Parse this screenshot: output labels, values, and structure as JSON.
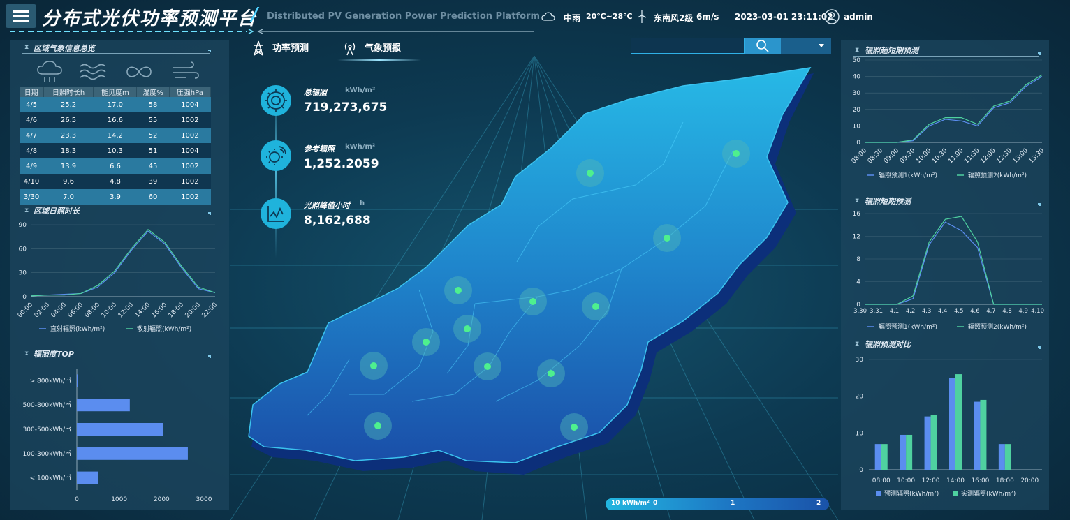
{
  "header": {
    "title": "分布式光伏功率预测平台",
    "subtitle": "Distributed PV Generation Power Prediction Platform",
    "weather": "中雨",
    "temperature": "20℃~28℃",
    "wind": "东南风2级",
    "wind_speed": "6m/s",
    "datetime": "2023-03-01 23:11:02",
    "user": "admin"
  },
  "colors": {
    "series1": "#5b8def",
    "series2": "#4fd1a0",
    "accent": "#1fb3dc"
  },
  "nav": {
    "tab1": "功率预测",
    "tab2": "气象预报"
  },
  "search": {
    "placeholder": ""
  },
  "kpis": [
    {
      "label": "总辐照",
      "unit": "kWh/m²",
      "value": "719,273,675"
    },
    {
      "label": "参考辐照",
      "unit": "kWh/m²",
      "value": "1,252.2059"
    },
    {
      "label": "光照峰值小时",
      "unit": "h",
      "value": "8,162,688"
    }
  ],
  "legend_scale": {
    "u": "10",
    "unit": "kWh/m²",
    "l0": "0",
    "l1": "1",
    "l2": "2"
  },
  "weather_panel": {
    "title": "区域气象信息总览",
    "icons": [
      "rain-icon",
      "waves-icon",
      "infinity-icon",
      "wind-icon"
    ],
    "headers": [
      "日期",
      "日照时长h",
      "能见度m",
      "湿度%",
      "压强hPa"
    ],
    "rows": [
      [
        "4/5",
        "25.2",
        "17.0",
        "58",
        "1004"
      ],
      [
        "4/6",
        "26.5",
        "16.6",
        "55",
        "1002"
      ],
      [
        "4/7",
        "23.3",
        "14.2",
        "52",
        "1002"
      ],
      [
        "4/8",
        "18.3",
        "10.3",
        "51",
        "1004"
      ],
      [
        "4/9",
        "13.9",
        "6.6",
        "45",
        "1002"
      ],
      [
        "4/10",
        "9.6",
        "4.8",
        "39",
        "1002"
      ],
      [
        "3/30",
        "7.0",
        "3.9",
        "60",
        "1002"
      ]
    ]
  },
  "panel_titles": {
    "sunshine": "区域日照时长",
    "top": "辐照度TOP",
    "ultra": "辐照超短期预测",
    "short": "辐照短期预测",
    "compare": "辐照预测对比"
  },
  "chart_data": [
    {
      "id": "sunshine",
      "type": "line",
      "x": [
        "00:00",
        "02:00",
        "04:00",
        "06:00",
        "08:00",
        "10:00",
        "12:00",
        "14:00",
        "16:00",
        "18:00",
        "20:00",
        "22:00"
      ],
      "ylim": [
        0,
        90
      ],
      "yticks": [
        0,
        30,
        60,
        90
      ],
      "series": [
        {
          "name": "直射辐照(kWh/m²)",
          "values": [
            1,
            2,
            3,
            4,
            12,
            30,
            58,
            82,
            66,
            36,
            10,
            5
          ]
        },
        {
          "name": "散射辐照(kWh/m²)",
          "values": [
            1,
            2,
            2,
            4,
            14,
            32,
            60,
            84,
            68,
            38,
            12,
            5
          ]
        }
      ]
    },
    {
      "id": "top",
      "type": "bar",
      "orientation": "horizontal",
      "categories": [
        "> 800kWh/㎡",
        "500-800kWh/㎡",
        "300-500kWh/㎡",
        "100-300kWh/㎡",
        "< 100kWh/㎡"
      ],
      "values": [
        10,
        1250,
        2030,
        2620,
        510
      ],
      "xlim": [
        0,
        3000
      ],
      "xticks": [
        0,
        1000,
        2000,
        3000
      ]
    },
    {
      "id": "ultra",
      "type": "line",
      "x": [
        "08:00",
        "08:30",
        "09:00",
        "09:30",
        "10:00",
        "10:30",
        "11:00",
        "11:30",
        "12:00",
        "12:30",
        "13:00",
        "13:30"
      ],
      "ylim": [
        0,
        50
      ],
      "yticks": [
        0,
        10,
        20,
        30,
        40,
        50
      ],
      "series": [
        {
          "name": "辐照预测1(kWh/m²)",
          "values": [
            0,
            0,
            0,
            1,
            10,
            14,
            13,
            10,
            21,
            24,
            34,
            40
          ]
        },
        {
          "name": "辐照预测2(kWh/m²)",
          "values": [
            0,
            0,
            0,
            1.5,
            11,
            15,
            15,
            11,
            22,
            25,
            35,
            41
          ]
        }
      ]
    },
    {
      "id": "short",
      "type": "line",
      "x": [
        "3.30",
        "3.31",
        "4.1",
        "4.2",
        "4.3",
        "4.4",
        "4.5",
        "4.6",
        "4.7",
        "4.8",
        "4.9",
        "4.10"
      ],
      "ylim": [
        0,
        16
      ],
      "yticks": [
        0,
        4,
        8,
        12,
        16
      ],
      "series": [
        {
          "name": "辐照预测1(kWh/m²)",
          "values": [
            0,
            0,
            0,
            1,
            10.5,
            14.5,
            13,
            10,
            0,
            0,
            0,
            0
          ]
        },
        {
          "name": "辐照预测2(kWh/m²)",
          "values": [
            0,
            0,
            0,
            1.5,
            11,
            15,
            15.5,
            11,
            0,
            0,
            0,
            0
          ]
        }
      ]
    },
    {
      "id": "compare",
      "type": "bar",
      "categories": [
        "08:00",
        "10:00",
        "12:00",
        "14:00",
        "16:00",
        "18:00",
        "20:00"
      ],
      "ylim": [
        0,
        30
      ],
      "yticks": [
        0,
        10,
        20,
        30
      ],
      "series": [
        {
          "name": "预测辐照(kWh/m²)",
          "values": [
            7,
            9.5,
            14.5,
            25,
            18.5,
            7,
            0
          ]
        },
        {
          "name": "实测辐照(kWh/m²)",
          "values": [
            7,
            9.5,
            15,
            26,
            19,
            7,
            0
          ]
        }
      ]
    }
  ]
}
